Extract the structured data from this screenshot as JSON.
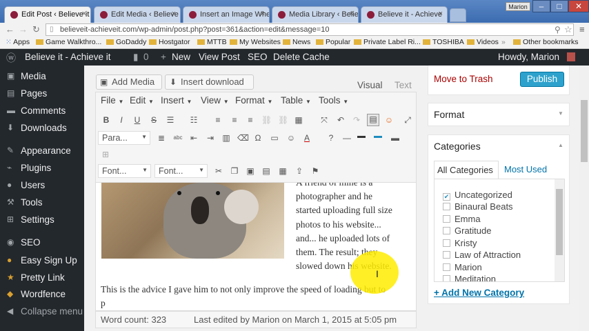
{
  "browser": {
    "tabs": [
      {
        "label": "Edit Post ‹ Believe it"
      },
      {
        "label": "Edit Media ‹ Believe"
      },
      {
        "label": "Insert an Image Whe"
      },
      {
        "label": "Media Library ‹ Belie"
      },
      {
        "label": "Believe it - Achieve"
      }
    ],
    "user_chip": "Marion",
    "url": "believeit-achieveit.com/wp-admin/post.php?post=361&action=edit&message=10",
    "bookmarks": [
      "Apps",
      "Game Walkthro...",
      "GoDaddy",
      "Hostgator",
      "MTTB",
      "My Websites",
      "News",
      "Popular",
      "Private Label Ri...",
      "TOSHIBA",
      "Videos"
    ],
    "other_bookmarks": "Other bookmarks"
  },
  "adminbar": {
    "site": "Believe it - Achieve it",
    "comments": "0",
    "new": "New",
    "view_post": "View Post",
    "seo": "SEO",
    "delete_cache": "Delete Cache",
    "howdy": "Howdy, Marion"
  },
  "sidebar": {
    "items": [
      {
        "label": "Media",
        "icon": "media-icon"
      },
      {
        "label": "Pages",
        "icon": "pages-icon"
      },
      {
        "label": "Comments",
        "icon": "comments-icon"
      },
      {
        "label": "Downloads",
        "icon": "downloads-icon"
      },
      {
        "label": "Appearance",
        "icon": "appearance-icon"
      },
      {
        "label": "Plugins",
        "icon": "plugins-icon"
      },
      {
        "label": "Users",
        "icon": "users-icon"
      },
      {
        "label": "Tools",
        "icon": "tools-icon"
      },
      {
        "label": "Settings",
        "icon": "settings-icon"
      },
      {
        "label": "SEO",
        "icon": "seo-icon"
      },
      {
        "label": "Easy Sign Up",
        "icon": "easy-sign-up-icon"
      },
      {
        "label": "Pretty Link",
        "icon": "pretty-link-icon"
      },
      {
        "label": "Wordfence",
        "icon": "wordfence-icon"
      },
      {
        "label": "Collapse menu",
        "icon": "collapse-icon"
      }
    ]
  },
  "editor": {
    "add_media": "Add Media",
    "insert_download": "Insert download",
    "tab_visual": "Visual",
    "tab_text": "Text",
    "menus": [
      "File",
      "Edit",
      "Insert",
      "View",
      "Format",
      "Table",
      "Tools"
    ],
    "paragraph_select": "Para...",
    "font_family_select": "Font...",
    "font_size_select": "Font...",
    "content_lines": [
      "A friend of mine is a",
      "photographer and he",
      "started uploading full size",
      "photos to his website...",
      "and... he uploaded lots of",
      "them. The result; they",
      "slowed down his website."
    ],
    "paragraph_2": "This is the advice I gave him to not only improve the speed of loading but to",
    "paragraph_2_cont": "p",
    "word_count": "Word count: 323",
    "last_edited": "Last edited by Marion on March 1, 2015 at 5:05 pm"
  },
  "publish_box": {
    "move_to_trash": "Move to Trash",
    "publish": "Publish"
  },
  "format_box": {
    "title": "Format"
  },
  "categories_box": {
    "title": "Categories",
    "tab_all": "All Categories",
    "tab_most_used": "Most Used",
    "items": [
      {
        "label": "Uncategorized",
        "checked": true
      },
      {
        "label": "Binaural Beats",
        "checked": false
      },
      {
        "label": "Emma",
        "checked": false
      },
      {
        "label": "Gratitude",
        "checked": false
      },
      {
        "label": "Kristy",
        "checked": false
      },
      {
        "label": "Law of Attraction",
        "checked": false
      },
      {
        "label": "Marion",
        "checked": false
      },
      {
        "label": "Meditation",
        "checked": false
      }
    ],
    "add_new": "+ Add New Category"
  },
  "colors": {
    "admin_dark": "#23282d",
    "link_blue": "#0073aa",
    "publish_blue": "#2ea2cc",
    "trash_red": "#a00",
    "cursor_highlight": "#ffec00"
  }
}
